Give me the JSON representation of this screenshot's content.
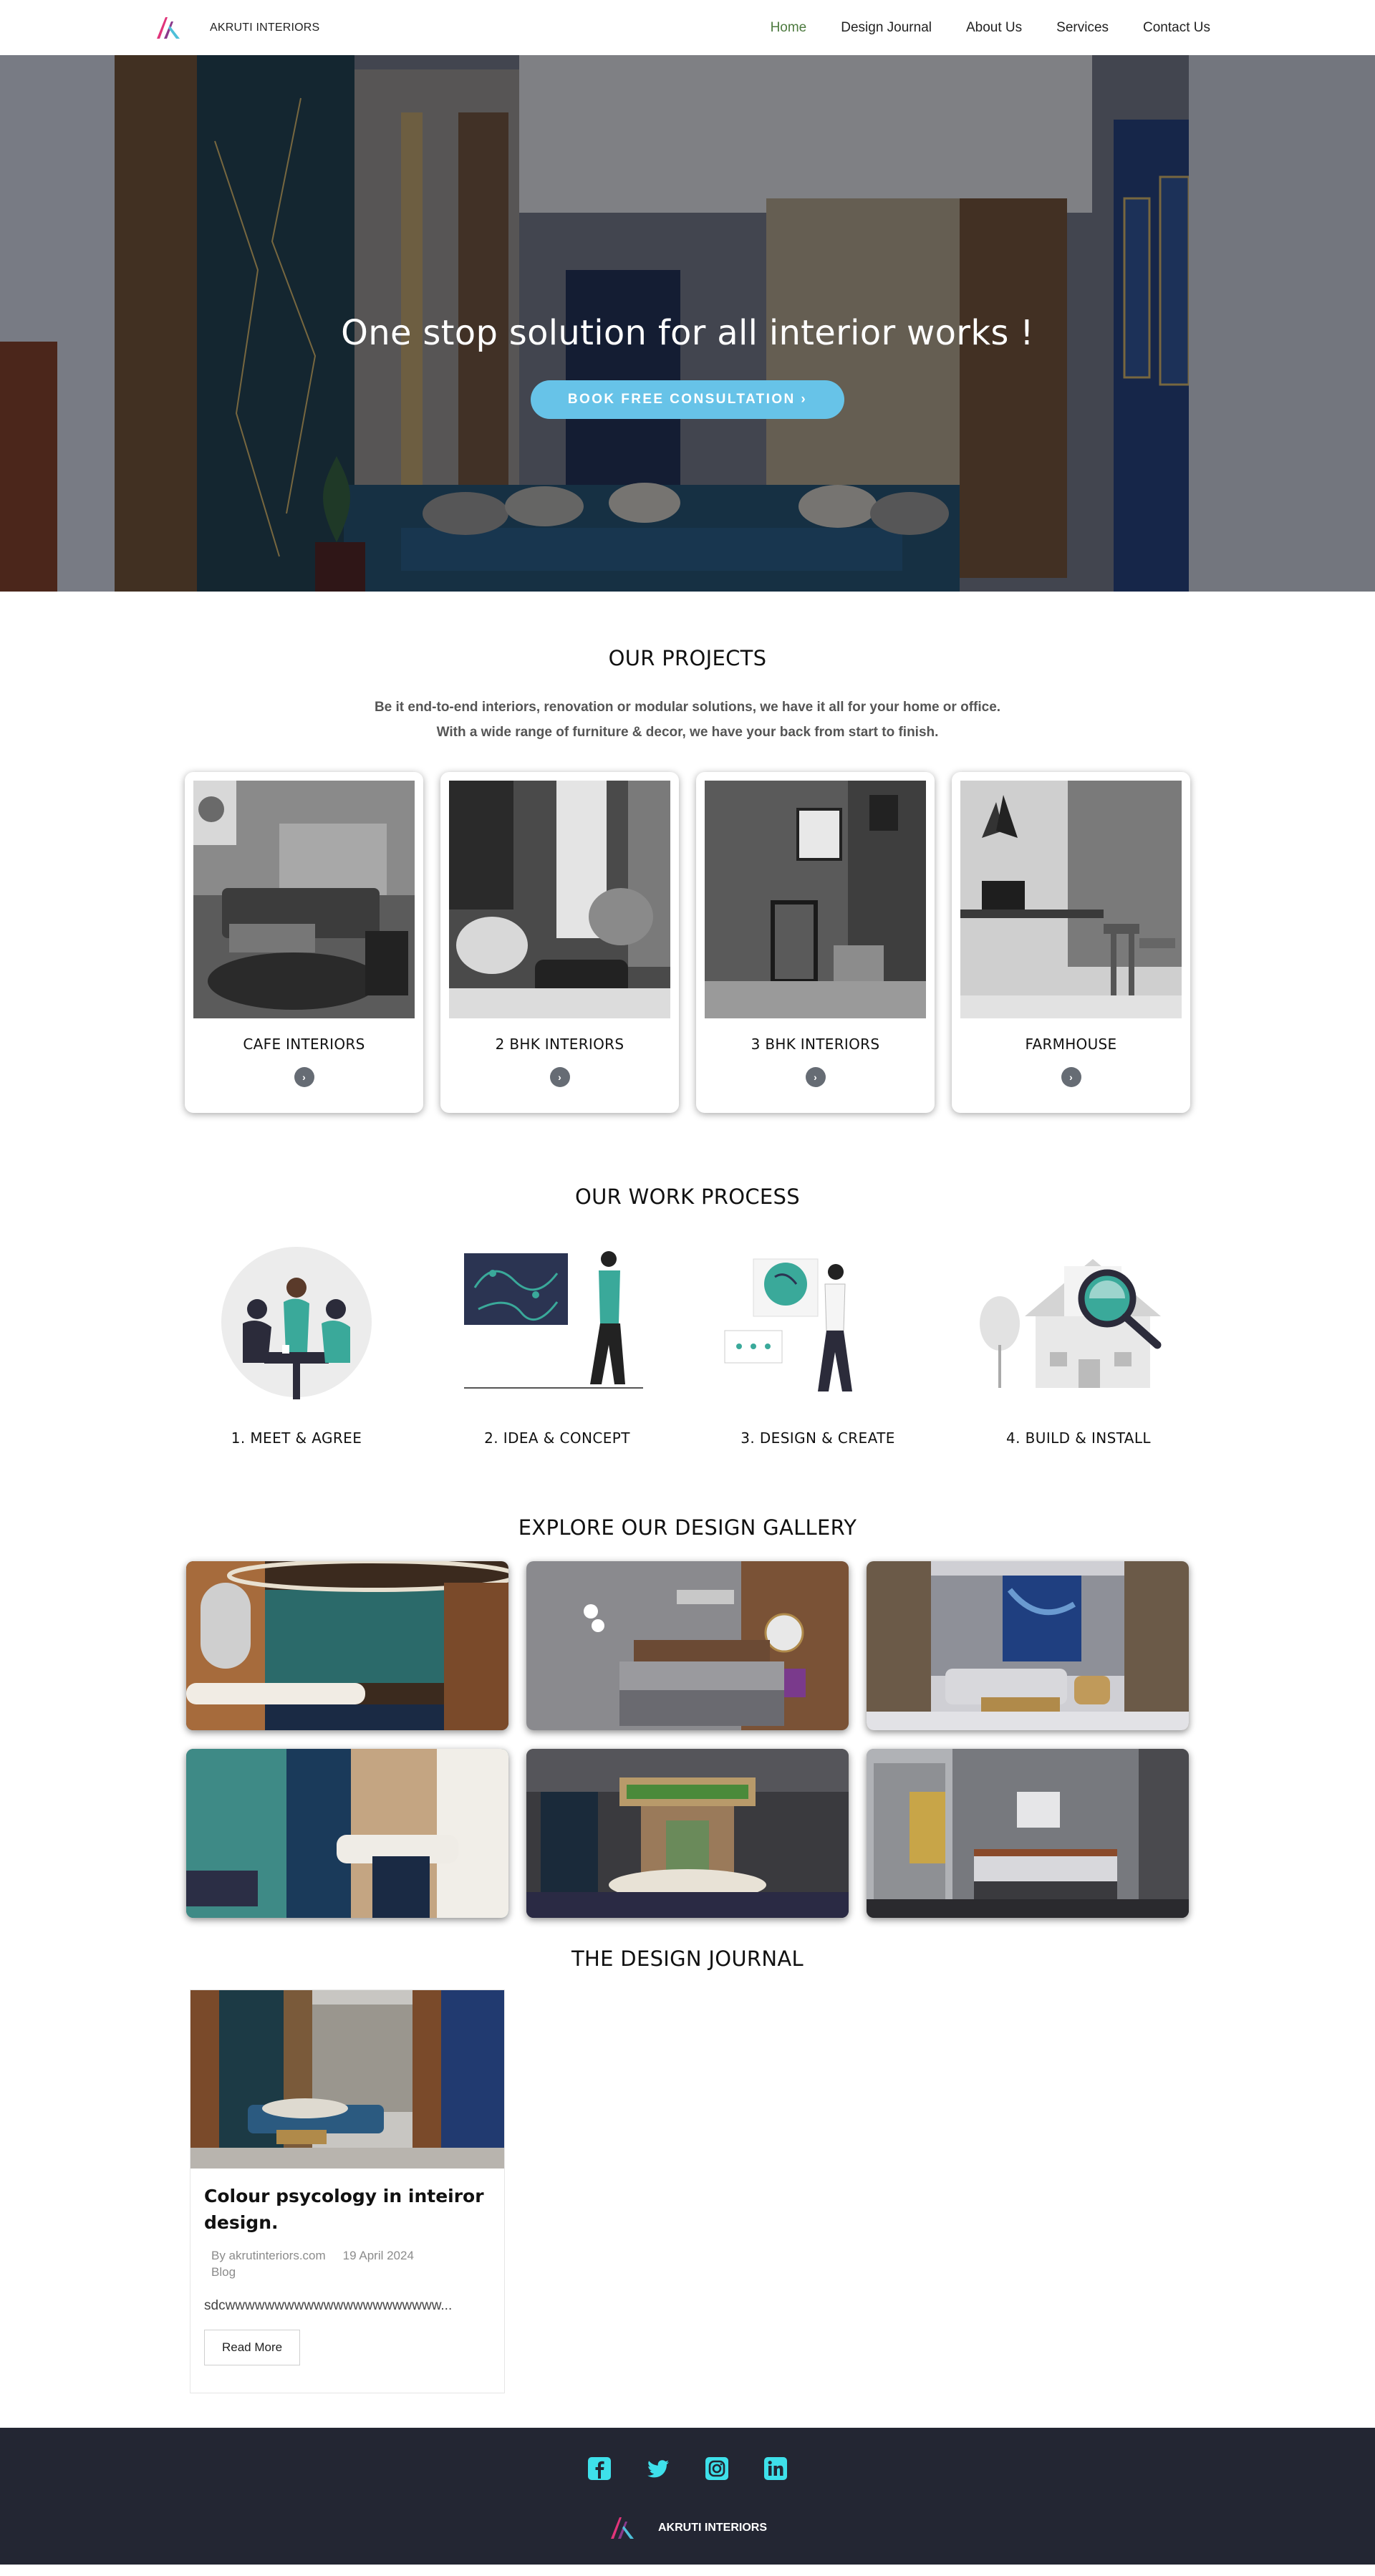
{
  "brand": {
    "name": "AKRUTI INTERIORS"
  },
  "nav": {
    "items": [
      {
        "label": "Home",
        "active": true
      },
      {
        "label": "Design Journal",
        "active": false
      },
      {
        "label": "About Us",
        "active": false
      },
      {
        "label": "Services",
        "active": false
      },
      {
        "label": "Contact Us",
        "active": false
      }
    ]
  },
  "hero": {
    "title": "One stop solution for all interior works !",
    "cta": "BOOK FREE CONSULTATION ›"
  },
  "projects": {
    "title": "OUR PROJECTS",
    "description": "Be it end-to-end interiors, renovation or modular solutions, we have it all for your home or office. With a wide range of furniture & decor, we have your back from start to finish.",
    "cards": [
      {
        "label": "CAFE INTERIORS"
      },
      {
        "label": "2 BHK INTERIORS"
      },
      {
        "label": "3 BHK INTERIORS"
      },
      {
        "label": "FARMHOUSE"
      }
    ],
    "arrow": "›"
  },
  "process": {
    "title": "OUR WORK PROCESS",
    "steps": [
      {
        "label": "1. MEET & AGREE"
      },
      {
        "label": "2. IDEA & CONCEPT"
      },
      {
        "label": "3. DESIGN & CREATE"
      },
      {
        "label": "4. BUILD & INSTALL"
      }
    ]
  },
  "gallery": {
    "title": "EXPLORE OUR DESIGN GALLERY"
  },
  "journal": {
    "title": "THE DESIGN JOURNAL",
    "post": {
      "title": "Colour psycology in inteiror design.",
      "author": "By akrutinteriors.com",
      "date": "19 April 2024",
      "category": "Blog",
      "excerpt": "sdcwwwwwwwwwwwwwwwwwwwwww...",
      "read_more": "Read More"
    }
  },
  "footer": {
    "socials": [
      "facebook-icon",
      "twitter-icon",
      "instagram-icon",
      "linkedin-icon"
    ],
    "brand": "AKRUTI INTERIORS"
  },
  "colors": {
    "accent_nav": "#4d7a3f",
    "cta": "#67c3e8",
    "footer_bg": "#232633",
    "social_icons": "#3ee0ea"
  }
}
